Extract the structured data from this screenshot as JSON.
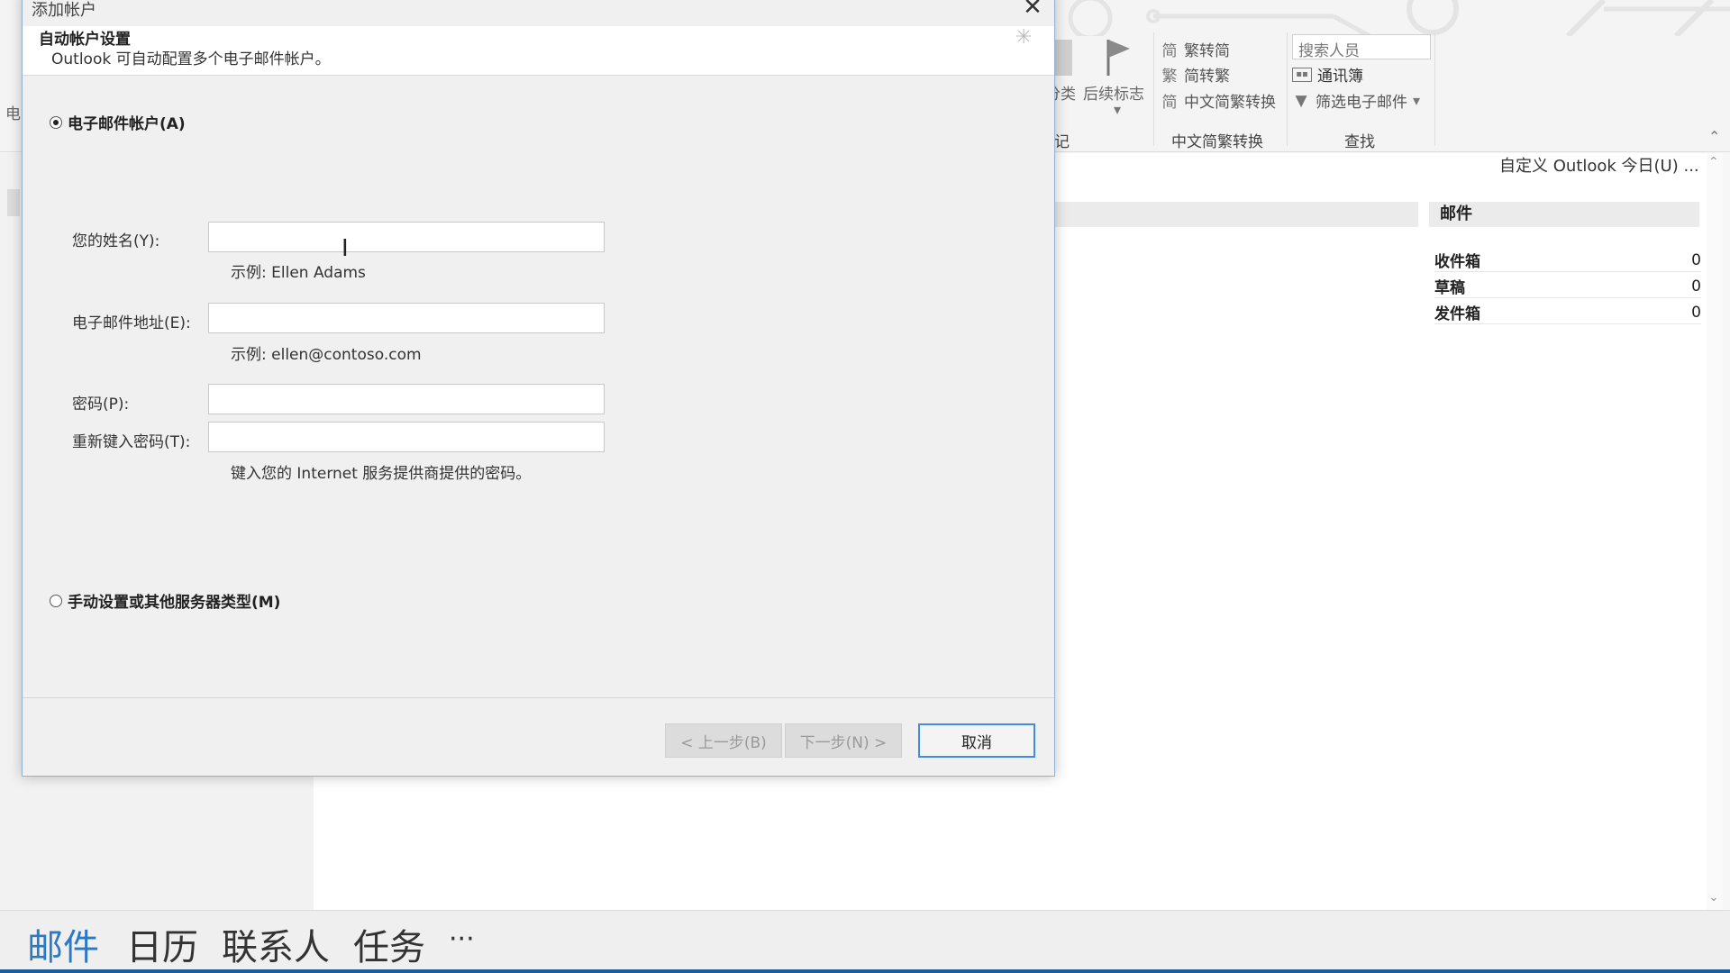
{
  "dialog": {
    "title": "添加帐户",
    "close_glyph": "✕",
    "header_title": "自动帐户设置",
    "header_subtitle": "Outlook 可自动配置多个电子邮件帐户。",
    "option_email": "电子邮件帐户(A)",
    "option_manual": "手动设置或其他服务器类型(M)",
    "name_label": "您的姓名(Y):",
    "name_value": "",
    "name_hint": "示例: Ellen Adams",
    "email_label": "电子邮件地址(E):",
    "email_value": "",
    "email_hint": "示例: ellen@contoso.com",
    "password_label": "密码(P):",
    "password_value": "",
    "retype_label": "重新键入密码(T):",
    "retype_value": "",
    "password_hint": "键入您的 Internet 服务提供商提供的密码。",
    "back_button": "< 上一步(B)",
    "next_button": "下一步(N) >",
    "cancel_button": "取消"
  },
  "ribbon": {
    "partial_category": "分类",
    "followup": "后续标志",
    "partial_group": "记",
    "trad_to_simp": "繁转简",
    "simp_to_trad": "简转繁",
    "conversion": "中文简繁转换",
    "group_chinese": "中文简繁转换",
    "search_people": "搜索人员",
    "address_book": "通讯簿",
    "filter_email": "筛选电子邮件",
    "group_find": "查找",
    "left_partial": "电"
  },
  "today": {
    "customize": "自定义 Outlook 今日(U) ...",
    "mail_header": "邮件",
    "rows": [
      {
        "label": "收件箱",
        "count": "0"
      },
      {
        "label": "草稿",
        "count": "0"
      },
      {
        "label": "发件箱",
        "count": "0"
      }
    ]
  },
  "bottom_nav": {
    "mail": "邮件",
    "calendar": "日历",
    "contacts": "联系人",
    "tasks": "任务",
    "more": "···"
  },
  "colors": {
    "accent": "#2b78c5",
    "dialog_border": "#8fb1d4",
    "primary_button_border": "#3d8ee0"
  }
}
